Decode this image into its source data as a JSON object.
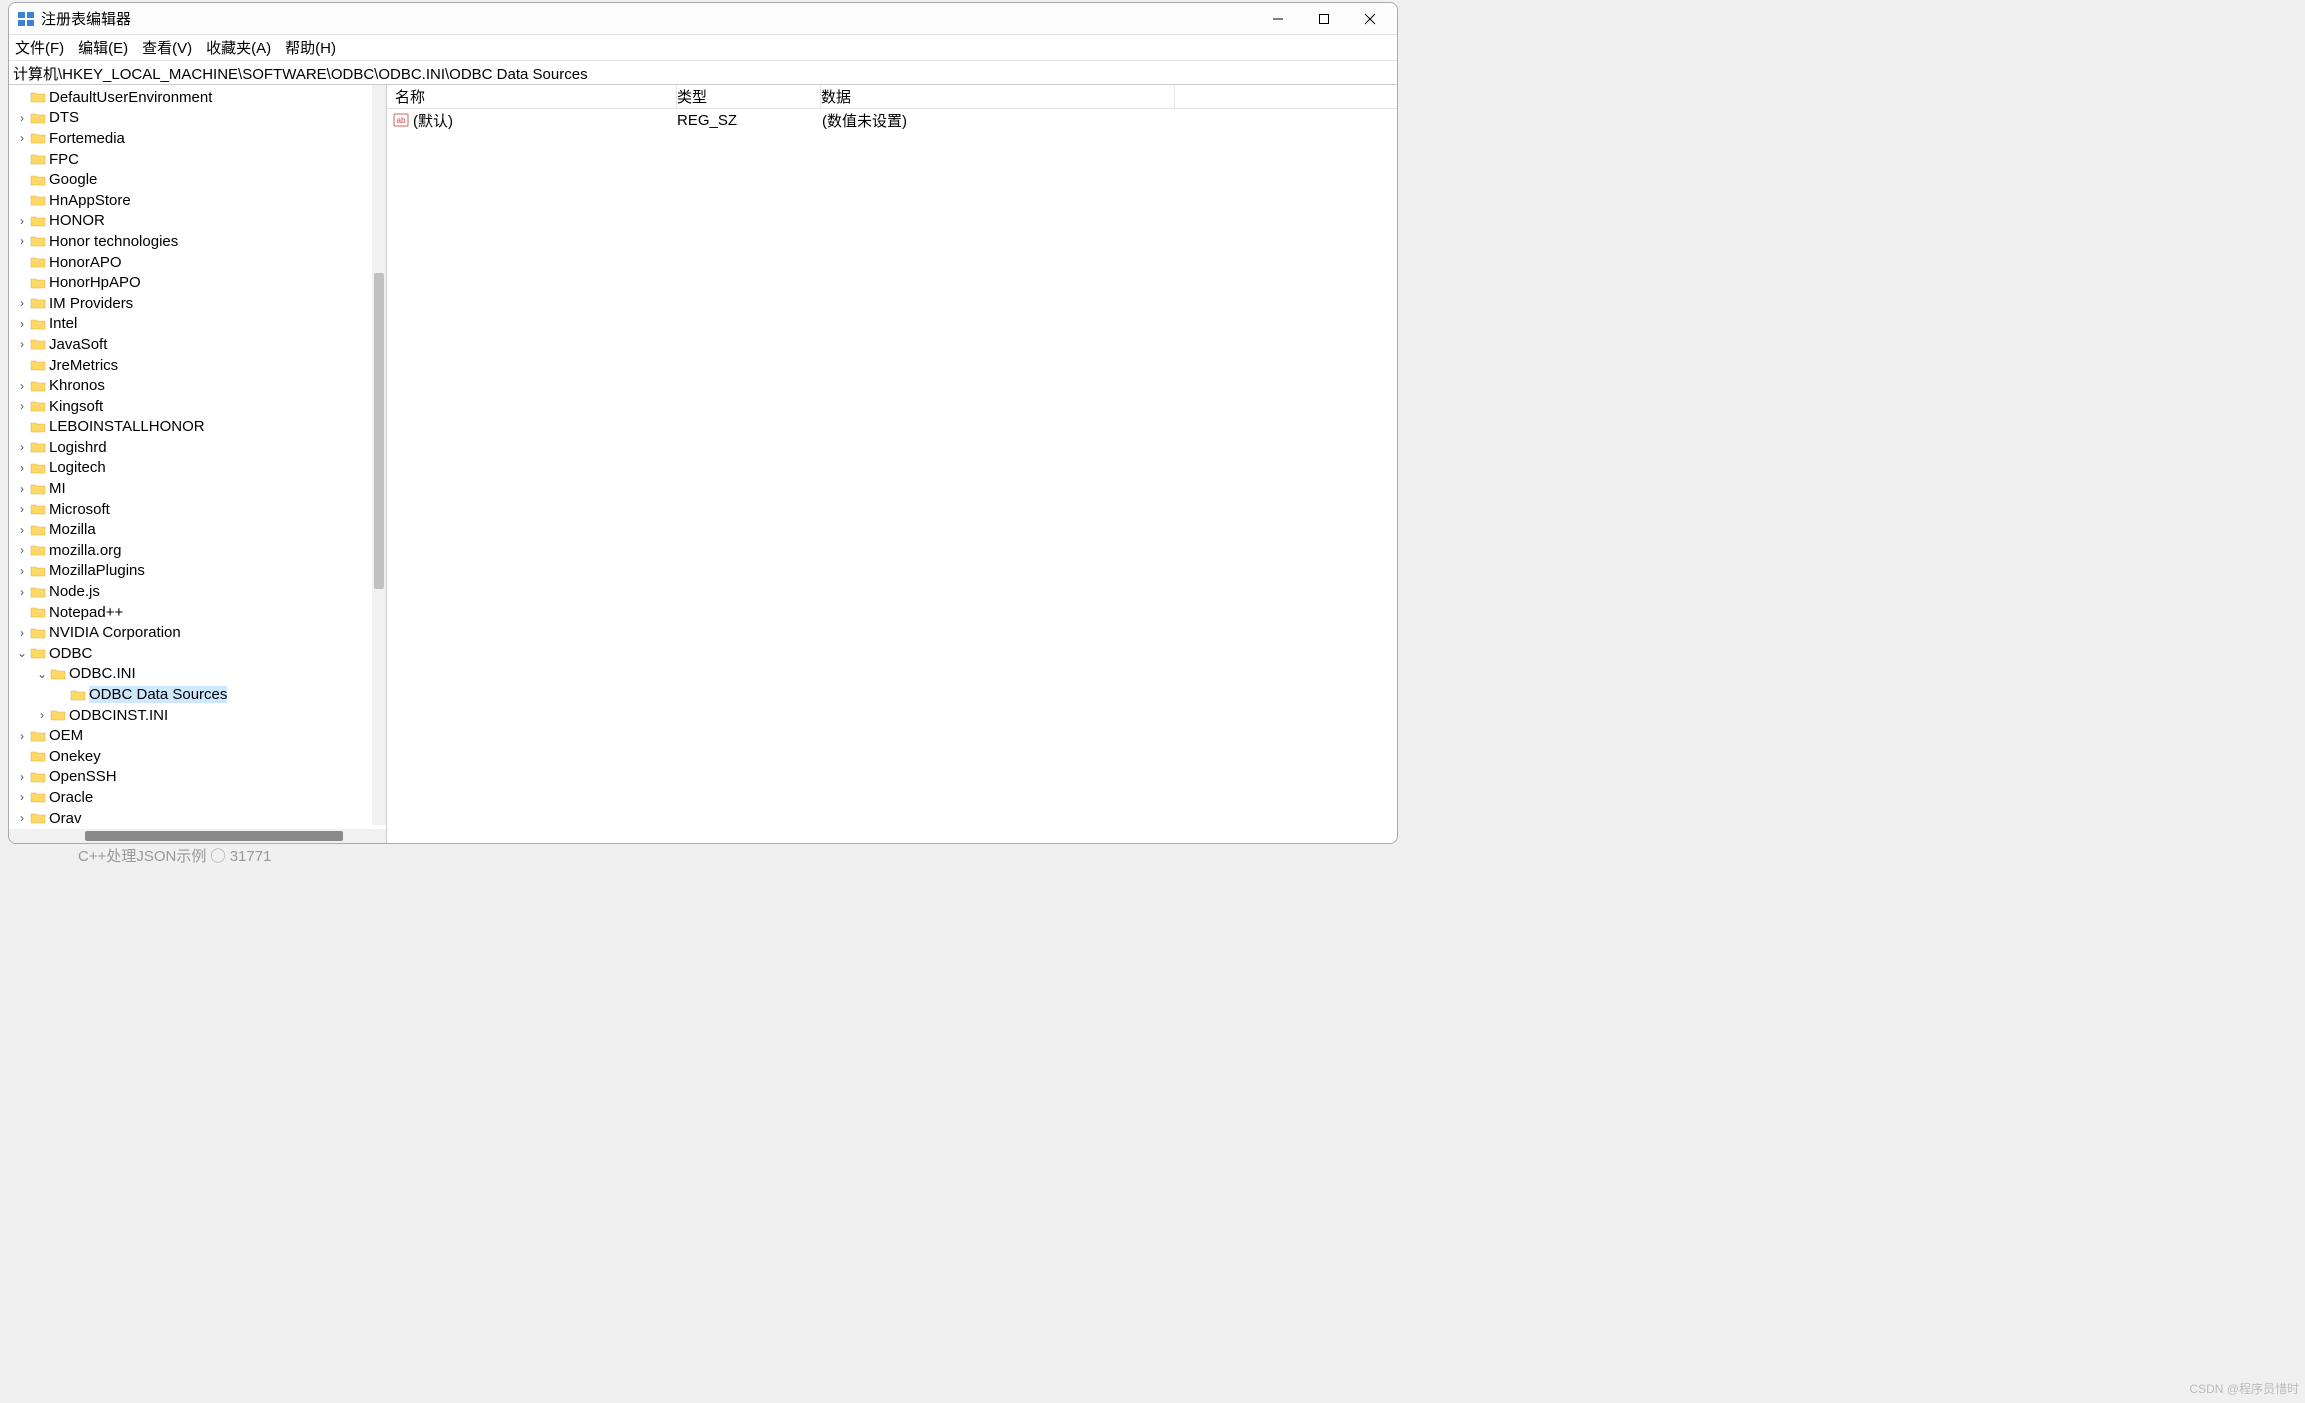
{
  "window": {
    "title": "注册表编辑器"
  },
  "menu": {
    "file": "文件(F)",
    "edit": "编辑(E)",
    "view": "查看(V)",
    "favorites": "收藏夹(A)",
    "help": "帮助(H)"
  },
  "address": "计算机\\HKEY_LOCAL_MACHINE\\SOFTWARE\\ODBC\\ODBC.INI\\ODBC Data Sources",
  "tree": [
    {
      "indent": 1,
      "expander": "",
      "label": "DefaultUserEnvironment"
    },
    {
      "indent": 1,
      "expander": "›",
      "label": "DTS"
    },
    {
      "indent": 1,
      "expander": "›",
      "label": "Fortemedia"
    },
    {
      "indent": 1,
      "expander": "",
      "label": "FPC"
    },
    {
      "indent": 1,
      "expander": "",
      "label": "Google"
    },
    {
      "indent": 1,
      "expander": "",
      "label": "HnAppStore"
    },
    {
      "indent": 1,
      "expander": "›",
      "label": "HONOR"
    },
    {
      "indent": 1,
      "expander": "›",
      "label": "Honor technologies"
    },
    {
      "indent": 1,
      "expander": "",
      "label": "HonorAPO"
    },
    {
      "indent": 1,
      "expander": "",
      "label": "HonorHpAPO"
    },
    {
      "indent": 1,
      "expander": "›",
      "label": "IM Providers"
    },
    {
      "indent": 1,
      "expander": "›",
      "label": "Intel"
    },
    {
      "indent": 1,
      "expander": "›",
      "label": "JavaSoft"
    },
    {
      "indent": 1,
      "expander": "",
      "label": "JreMetrics"
    },
    {
      "indent": 1,
      "expander": "›",
      "label": "Khronos"
    },
    {
      "indent": 1,
      "expander": "›",
      "label": "Kingsoft"
    },
    {
      "indent": 1,
      "expander": "",
      "label": "LEBOINSTALLHONOR"
    },
    {
      "indent": 1,
      "expander": "›",
      "label": "Logishrd"
    },
    {
      "indent": 1,
      "expander": "›",
      "label": "Logitech"
    },
    {
      "indent": 1,
      "expander": "›",
      "label": "MI"
    },
    {
      "indent": 1,
      "expander": "›",
      "label": "Microsoft"
    },
    {
      "indent": 1,
      "expander": "›",
      "label": "Mozilla"
    },
    {
      "indent": 1,
      "expander": "›",
      "label": "mozilla.org"
    },
    {
      "indent": 1,
      "expander": "›",
      "label": "MozillaPlugins"
    },
    {
      "indent": 1,
      "expander": "›",
      "label": "Node.js"
    },
    {
      "indent": 1,
      "expander": "",
      "label": "Notepad++"
    },
    {
      "indent": 1,
      "expander": "›",
      "label": "NVIDIA Corporation"
    },
    {
      "indent": 1,
      "expander": "⌄",
      "label": "ODBC"
    },
    {
      "indent": 2,
      "expander": "⌄",
      "label": "ODBC.INI"
    },
    {
      "indent": 3,
      "expander": "",
      "label": "ODBC Data Sources",
      "selected": true
    },
    {
      "indent": 2,
      "expander": "›",
      "label": "ODBCINST.INI"
    },
    {
      "indent": 1,
      "expander": "›",
      "label": "OEM"
    },
    {
      "indent": 1,
      "expander": "",
      "label": "Onekey"
    },
    {
      "indent": 1,
      "expander": "›",
      "label": "OpenSSH"
    },
    {
      "indent": 1,
      "expander": "›",
      "label": "Oracle"
    },
    {
      "indent": 1,
      "expander": "›",
      "label": "Orav"
    }
  ],
  "columns": {
    "name": "名称",
    "type": "类型",
    "data": "数据"
  },
  "rows": [
    {
      "name": "(默认)",
      "type": "REG_SZ",
      "data": "(数值未设置)"
    }
  ],
  "watermark": "CSDN @程序员惜时",
  "bottom": "C++处理JSON示例  ◯ 31771"
}
